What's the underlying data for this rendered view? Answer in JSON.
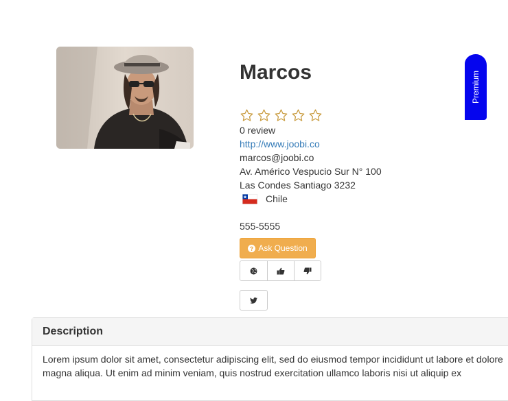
{
  "profile": {
    "name": "Marcos",
    "rating_stars": 5,
    "rating_value": 0,
    "review_count": "0 review",
    "website": "http://www.joobi.co",
    "email": "marcos@joobi.co",
    "address_line1": "Av. Américo Vespucio Sur N° 100",
    "address_line2": "Las Condes Santiago 3232",
    "country": "Chile",
    "phone": "555-5555"
  },
  "badge": {
    "label": "Premium"
  },
  "actions": {
    "ask_question_label": "Ask Question",
    "icons": [
      "globe-icon",
      "thumbs-up-icon",
      "thumbs-down-icon",
      "twitter-icon"
    ]
  },
  "description": {
    "heading": "Description",
    "text": "Lorem ipsum dolor sit amet, consectetur adipiscing elit, sed do eiusmod tempor incididunt ut labore et dolore magna aliqua. Ut enim ad minim veniam, quis nostrud exercitation ullamco laboris nisi ut aliquip ex"
  },
  "colors": {
    "link": "#337ab7",
    "warning_button": "#f0ad4e",
    "premium_badge": "#0505ee",
    "star_outline": "#c89a3c"
  }
}
